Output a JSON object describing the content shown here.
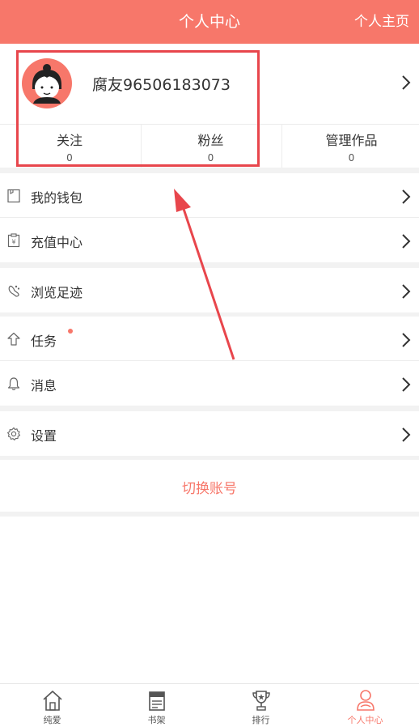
{
  "header": {
    "title": "个人中心",
    "right_link": "个人主页"
  },
  "profile": {
    "username": "腐友96506183073",
    "avatar_icon": "user-face-icon"
  },
  "stats": [
    {
      "label": "关注",
      "value": "0"
    },
    {
      "label": "粉丝",
      "value": "0"
    },
    {
      "label": "管理作品",
      "value": "0"
    }
  ],
  "menu": {
    "wallet": {
      "label": "我的钱包",
      "icon": "wallet-icon"
    },
    "recharge": {
      "label": "充值中心",
      "icon": "recharge-icon"
    },
    "history": {
      "label": "浏览足迹",
      "icon": "footprint-icon"
    },
    "tasks": {
      "label": "任务",
      "icon": "upload-arrow-icon"
    },
    "messages": {
      "label": "消息",
      "icon": "bell-icon"
    },
    "settings": {
      "label": "设置",
      "icon": "gear-icon"
    }
  },
  "switch_account": "切换账号",
  "tabs": [
    {
      "label": "纯爱",
      "icon": "home-icon"
    },
    {
      "label": "书架",
      "icon": "bookshelf-icon"
    },
    {
      "label": "排行",
      "icon": "trophy-icon"
    },
    {
      "label": "个人中心",
      "icon": "person-icon",
      "active": true
    }
  ],
  "colors": {
    "accent": "#f7776a",
    "highlight": "#e8464c",
    "gap": "#f2f2f2"
  }
}
